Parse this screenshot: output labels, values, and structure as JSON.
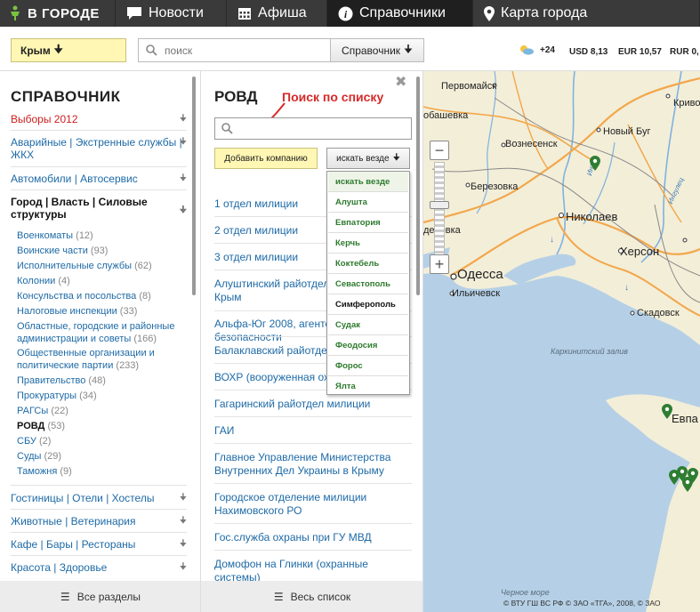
{
  "nav": {
    "logo": "В ГОРОДЕ",
    "items": [
      {
        "label": "Новости",
        "icon": "speech-bubble-icon"
      },
      {
        "label": "Афиша",
        "icon": "calendar-icon"
      },
      {
        "label": "Справочники",
        "icon": "info-icon"
      },
      {
        "label": "Карта города",
        "icon": "map-pin-icon"
      }
    ]
  },
  "toolbar": {
    "region": "Крым",
    "search_placeholder": "поиск",
    "search_scope": "Справочник",
    "temperature": "+24",
    "usd": "USD 8,13",
    "eur": "EUR 10,57",
    "rur": "RUR 0,"
  },
  "catalog": {
    "title": "СПРАВОЧНИК",
    "categories_top": [
      {
        "label": "Выборы 2012",
        "style": "red"
      },
      {
        "label": "Аварийные | Экстренные службы | ЖКХ"
      },
      {
        "label": "Автомобили | Автосервис"
      },
      {
        "label": "Город | Власть | Силовые структуры",
        "style": "bold"
      }
    ],
    "subitems": [
      {
        "label": "Военкоматы",
        "count": "(12)"
      },
      {
        "label": "Воинские части",
        "count": "(93)"
      },
      {
        "label": "Исполнительные службы",
        "count": "(62)"
      },
      {
        "label": "Колонии",
        "count": "(4)"
      },
      {
        "label": "Консульства и посольства",
        "count": "(8)"
      },
      {
        "label": "Налоговые инспекции",
        "count": "(33)"
      },
      {
        "label": "Областные, городские и районные администрации и советы",
        "count": "(166)"
      },
      {
        "label": "Общественные организации и политические партии",
        "count": "(233)"
      },
      {
        "label": "Правительство",
        "count": "(48)"
      },
      {
        "label": "Прокуратуры",
        "count": "(34)"
      },
      {
        "label": "РАГСы",
        "count": "(22)"
      },
      {
        "label": "РОВД",
        "count": "(53)",
        "current": true
      },
      {
        "label": "СБУ",
        "count": "(2)"
      },
      {
        "label": "Суды",
        "count": "(29)"
      },
      {
        "label": "Таможня",
        "count": "(9)"
      }
    ],
    "categories_bottom": [
      {
        "label": "Гостиницы | Отели | Хостелы"
      },
      {
        "label": "Животные | Ветеринария"
      },
      {
        "label": "Кафе | Бары | Рестораны"
      },
      {
        "label": "Красота | Здоровье"
      }
    ],
    "footer": "Все разделы"
  },
  "listing": {
    "title": "РОВД",
    "hint": "Поиск по списку",
    "add_button": "Добавить компанию",
    "scope_button": "искать везде",
    "items": [
      "1 отдел милиции",
      "2 отдел милиции",
      "3 отдел милиции",
      "Алуштинский райотдел милиции в АР Крым",
      "Альфа-Юг 2008, агентство безопасности",
      "Балаклавский райотдел милиции",
      "ВОХР (вооруженная охрана)",
      "Гагаринский райотдел милиции",
      "ГАИ",
      "Главное Управление Министерства Внутренних Дел Украины в Крыму",
      "Городское отделение милиции Нахимовского РО",
      "Гос.служба охраны при ГУ МВД",
      "Домофон на Глинки (охранные системы)"
    ],
    "footer": "Весь список",
    "dropdown": [
      "искать везде",
      "Алушта",
      "Евпатория",
      "Керчь",
      "Коктебель",
      "Севастополь",
      "Симферополь",
      "Судак",
      "Феодосия",
      "Форос",
      "Ялта"
    ],
    "dropdown_selected": "Симферополь"
  },
  "map": {
    "labels": {
      "pervomaysk": "Первомайск",
      "krivoy": "Криво",
      "bashevka": "обашевка",
      "voznesensk": "Вознесенск",
      "noviy_bug": "Новый Буг",
      "inguls": "Ингул",
      "berezovka": "Березовка",
      "inguletz": "Ингулец",
      "nikolaev": "Николаев",
      "denovka": "деновка",
      "odessa": "Одесса",
      "herson": "Херсон",
      "ilichevsk": "Ильичевск",
      "skadovsk": "Скадовск",
      "karkinit": "Каркинитский залив",
      "evpa": "Евпа",
      "cherno": "Черное море"
    },
    "zoom_in": "+",
    "zoom_out": "−",
    "copyright": "© ВТУ ГШ ВС РФ © ЗАО «ТГА», 2008, © ЗАО",
    "colors": {
      "land": "#f3eed8",
      "sea": "#b5d0e6",
      "road": "#f2a74b",
      "marker": "#2e7d32"
    }
  }
}
